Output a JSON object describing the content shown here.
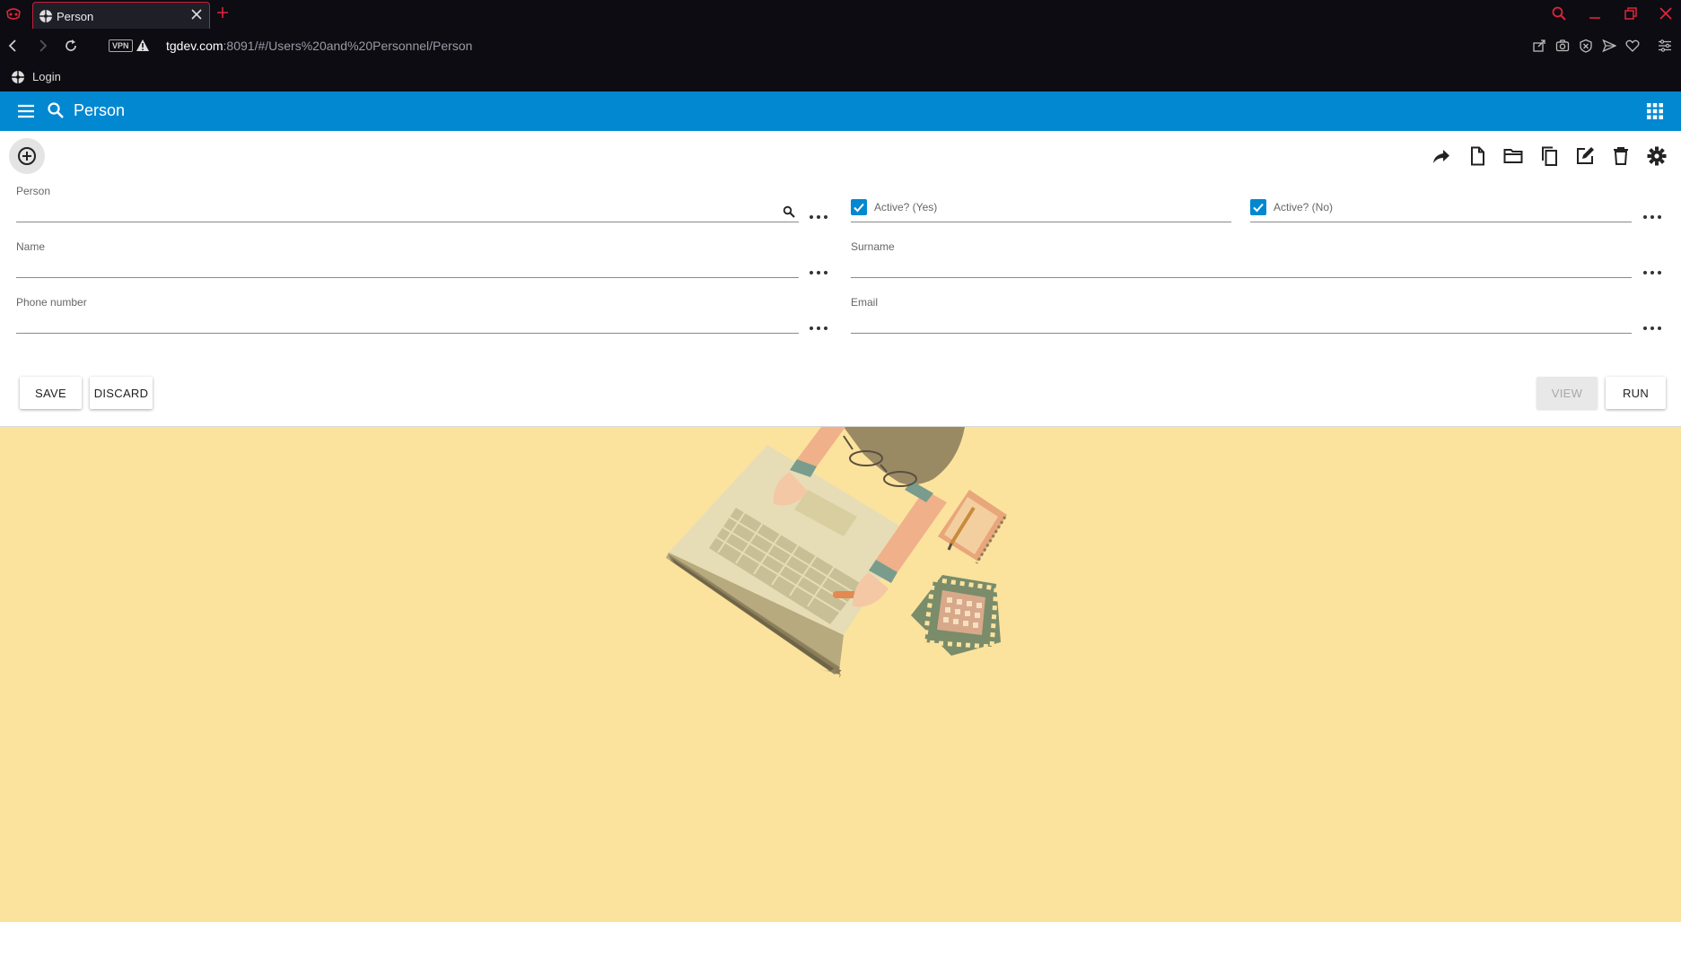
{
  "browser": {
    "tab_title": "Person",
    "url_host": "tgdev.com",
    "url_path": ":8091/#/Users%20and%20Personnel/Person",
    "vpn_label": "VPN",
    "bookmark_label": "Login"
  },
  "app": {
    "title": "Person",
    "accent_color": "#0288d1",
    "background_color": "#fbe39d"
  },
  "toolbar": {
    "icons": [
      "share-icon",
      "new-document-icon",
      "open-folder-icon",
      "copy-icon",
      "edit-icon",
      "delete-icon",
      "settings-icon"
    ]
  },
  "form": {
    "person": {
      "label": "Person",
      "value": ""
    },
    "active_yes": {
      "label": "Active? (Yes)",
      "checked": true
    },
    "active_no": {
      "label": "Active? (No)",
      "checked": true
    },
    "name": {
      "label": "Name",
      "value": ""
    },
    "surname": {
      "label": "Surname",
      "value": ""
    },
    "phone": {
      "label": "Phone number",
      "value": ""
    },
    "email": {
      "label": "Email",
      "value": ""
    }
  },
  "actions": {
    "save": "SAVE",
    "discard": "DISCARD",
    "view": "VIEW",
    "run": "RUN"
  }
}
